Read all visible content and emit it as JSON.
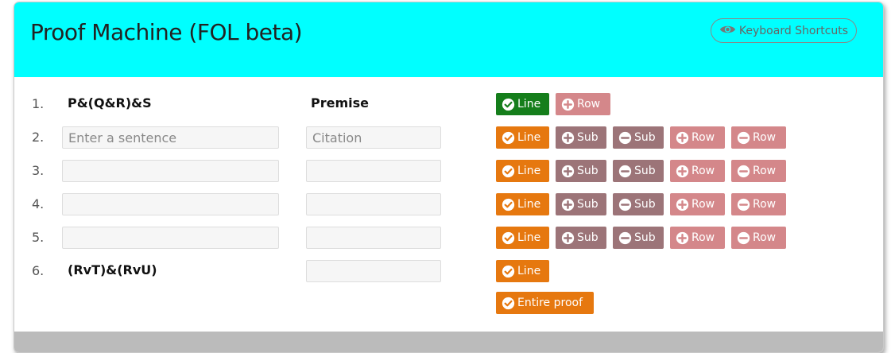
{
  "header": {
    "title": "Proof Machine (FOL beta)",
    "shortcuts_label": "Keyboard Shortcuts",
    "bg_color": "#00ffff"
  },
  "buttons": {
    "line": "Line",
    "sub": "Sub",
    "row": "Row",
    "entire_proof": "Entire proof"
  },
  "colors": {
    "line_confirmed": "#157e1b",
    "line": "#e6780f",
    "sub": "#9c7478",
    "row": "#d4878a"
  },
  "icons": {
    "check": "check-circle-icon",
    "plus": "plus-circle-icon",
    "minus": "minus-circle-icon",
    "eye": "eye-icon"
  },
  "proof": {
    "lines": [
      {
        "number": "1.",
        "sentence": "P&(Q&R)&S",
        "citation": "Premise"
      },
      {
        "number": "2.",
        "sentence_value": "",
        "sentence_placeholder": "Enter a sentence",
        "citation_value": "",
        "citation_placeholder": "Citation"
      },
      {
        "number": "3.",
        "sentence_value": "",
        "citation_value": ""
      },
      {
        "number": "4.",
        "sentence_value": "",
        "citation_value": ""
      },
      {
        "number": "5.",
        "sentence_value": "",
        "citation_value": ""
      },
      {
        "number": "6.",
        "sentence": "(RvT)&(RvU)",
        "citation_value": ""
      }
    ]
  }
}
